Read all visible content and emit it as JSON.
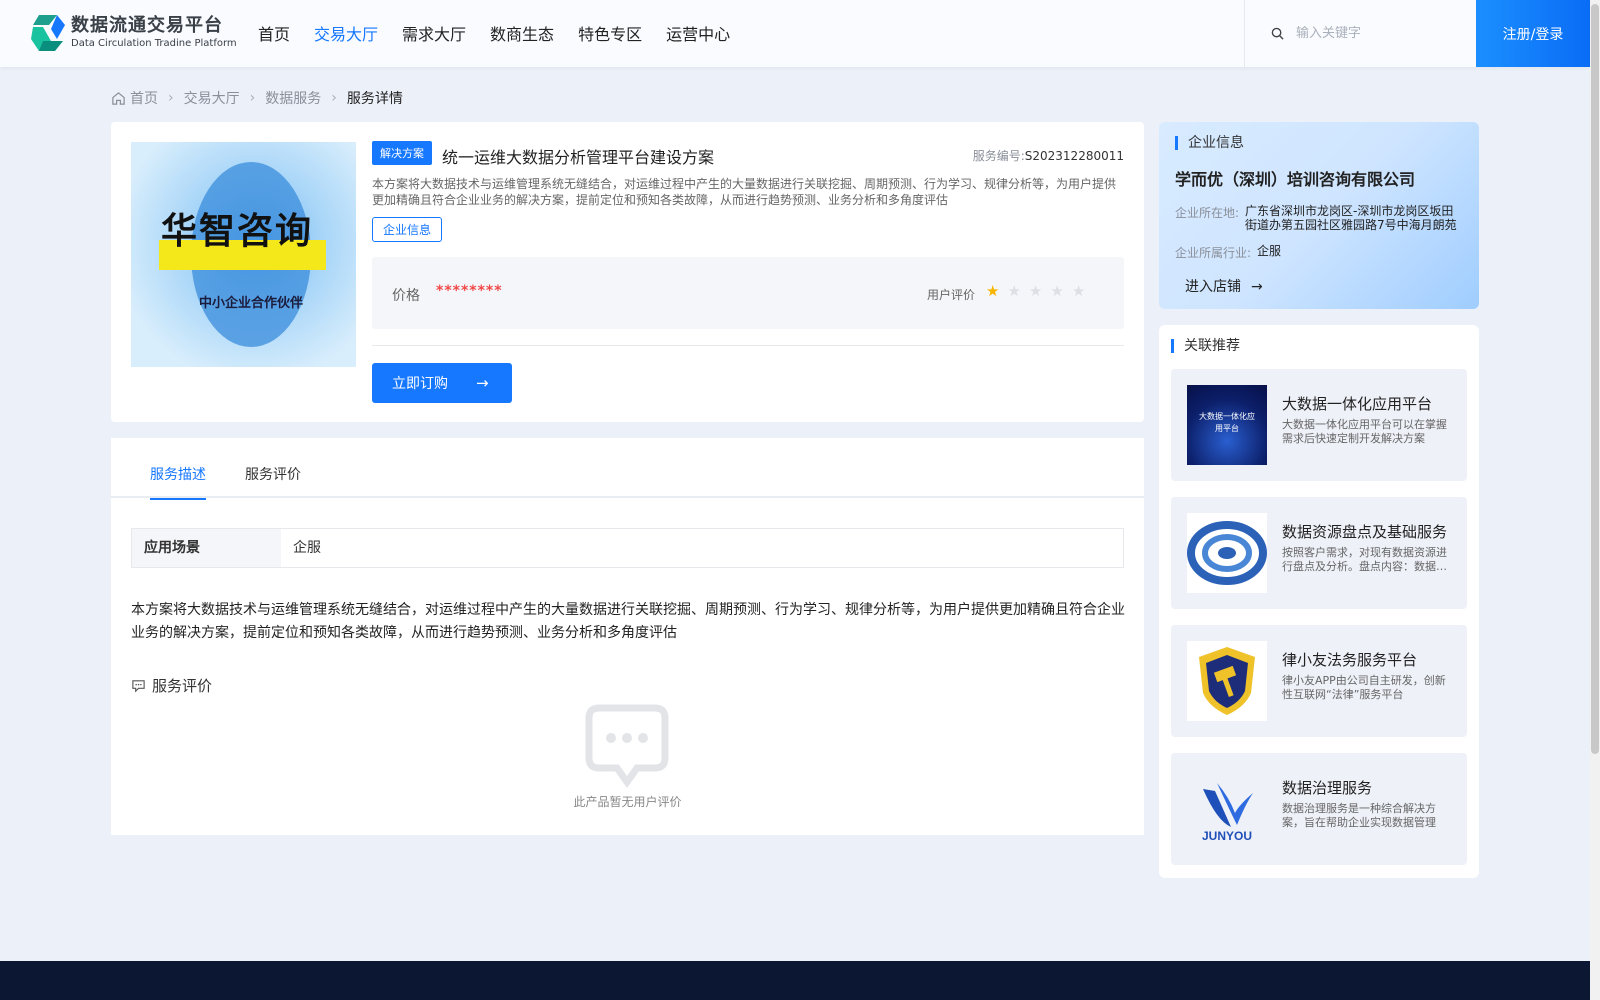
{
  "header": {
    "logo_cn": "数据流通交易平台",
    "logo_en": "Data Circulation Tradine Platform",
    "nav": [
      "首页",
      "交易大厅",
      "需求大厅",
      "数商生态",
      "特色专区",
      "运营中心"
    ],
    "active_nav_index": 1,
    "search_placeholder": "输入关键字",
    "login_label": "注册/登录"
  },
  "breadcrumb": [
    "首页",
    "交易大厅",
    "数据服务",
    "服务详情"
  ],
  "product": {
    "image_title": "华智咨询",
    "image_subtitle": "中小企业合作伙伴",
    "tag": "解决方案",
    "title": "统一运维大数据分析管理平台建设方案",
    "service_no_label": "服务编号:",
    "service_no": "S202312280011",
    "description": "本方案将大数据技术与运维管理系统无缝结合，对运维过程中产生的大量数据进行关联挖掘、周期预测、行为学习、规律分析等，为用户提供更加精确且符合企业业务的解决方案，提前定位和预知各类故障，从而进行趋势预测、业务分析和多角度评估",
    "company_link": "企业信息",
    "price_label": "价格",
    "price_value": "********",
    "rating_label": "用户评价",
    "rating": 1,
    "rating_max": 5,
    "order_label": "立即订购"
  },
  "detail": {
    "tabs": [
      "服务描述",
      "服务评价"
    ],
    "active_tab_index": 0,
    "scene_key": "应用场景",
    "scene_value": "企服",
    "long_description": "本方案将大数据技术与运维管理系统无缝结合，对运维过程中产生的大量数据进行关联挖掘、周期预测、行为学习、规律分析等，为用户提供更加精确且符合企业业务的解决方案，提前定位和预知各类故障，从而进行趋势预测、业务分析和多角度评估",
    "review_title": "服务评价",
    "empty_text": "此产品暂无用户评价"
  },
  "enterprise": {
    "section_title": "企业信息",
    "name": "学而优（深圳）培训咨询有限公司",
    "location_label": "企业所在地:",
    "location": "广东省深圳市龙岗区-深圳市龙岗区坂田街道办第五园社区雅园路7号中海月朗苑",
    "industry_label": "企业所属行业:",
    "industry": "企服",
    "enter_shop": "进入店铺"
  },
  "recommend": {
    "section_title": "关联推荐",
    "items": [
      {
        "title": "大数据一体化应用平台",
        "desc": "大数据一体化应用平台可以在掌握需求后快速定制开发解决方案",
        "thumb_text": "大数据一体化应用平台"
      },
      {
        "title": "数据资源盘点及基础服务",
        "desc": "按照客户需求，对现有数据资源进行盘点及分析。盘点内容：数据资源",
        "thumb_text": ""
      },
      {
        "title": "律小友法务服务平台",
        "desc": "律小友APP由公司自主研发，创新性互联网“法律”服务平台",
        "thumb_text": ""
      },
      {
        "title": "数据治理服务",
        "desc": "数据治理服务是一种综合解决方案，旨在帮助企业实现数据管理",
        "thumb_text": "JUNYOU"
      }
    ]
  },
  "colors": {
    "primary": "#1677ff",
    "price": "#f04848",
    "star": "#f7b500",
    "footer": "#0c1734"
  }
}
